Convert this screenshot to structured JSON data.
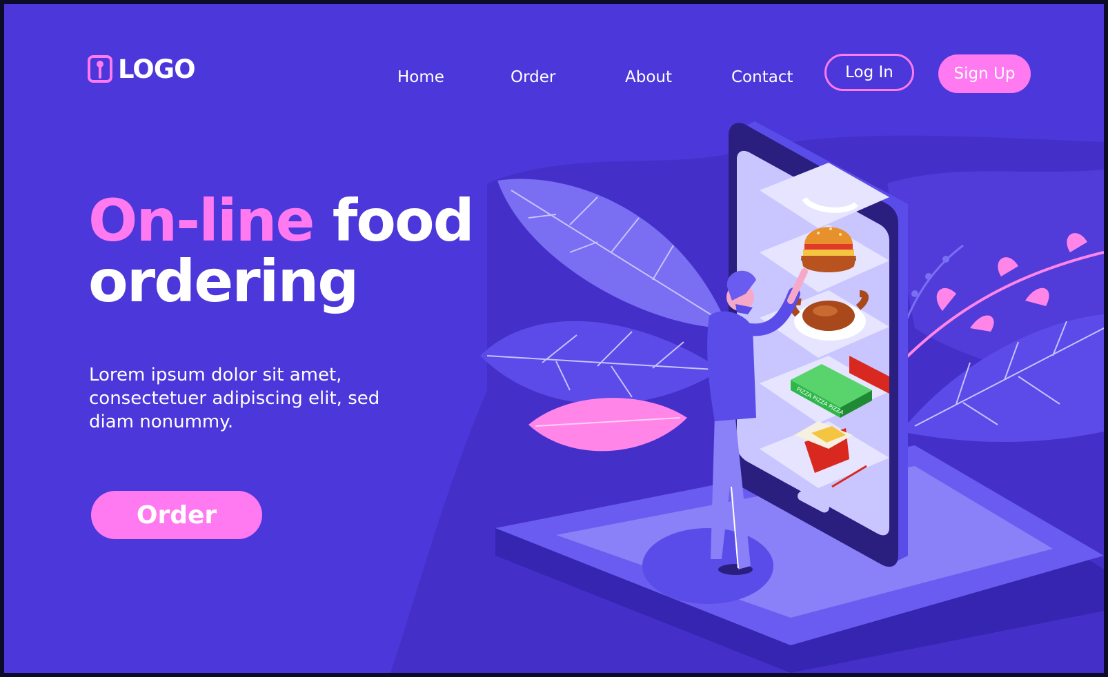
{
  "header": {
    "logo_text": "LOGO",
    "nav": [
      {
        "label": "Home"
      },
      {
        "label": "Order"
      },
      {
        "label": "About"
      },
      {
        "label": "Contact"
      }
    ],
    "login_label": "Log In",
    "signup_label": "Sign Up"
  },
  "hero": {
    "title_accent": "On-line",
    "title_rest_line1": "food",
    "title_line2": "ordering",
    "description": "Lorem ipsum dolor sit amet, consectetuer adipiscing elit, sed diam nonummy.",
    "order_button_label": "Order"
  },
  "illustration": {
    "pizza_box_text": "PIZZA PIZZA PIZZA"
  },
  "colors": {
    "background": "#4c37db",
    "accent_pink": "#ff7af0",
    "text": "#ffffff",
    "phone_body": "#2f2386",
    "phone_screen": "#c9c6ff"
  }
}
